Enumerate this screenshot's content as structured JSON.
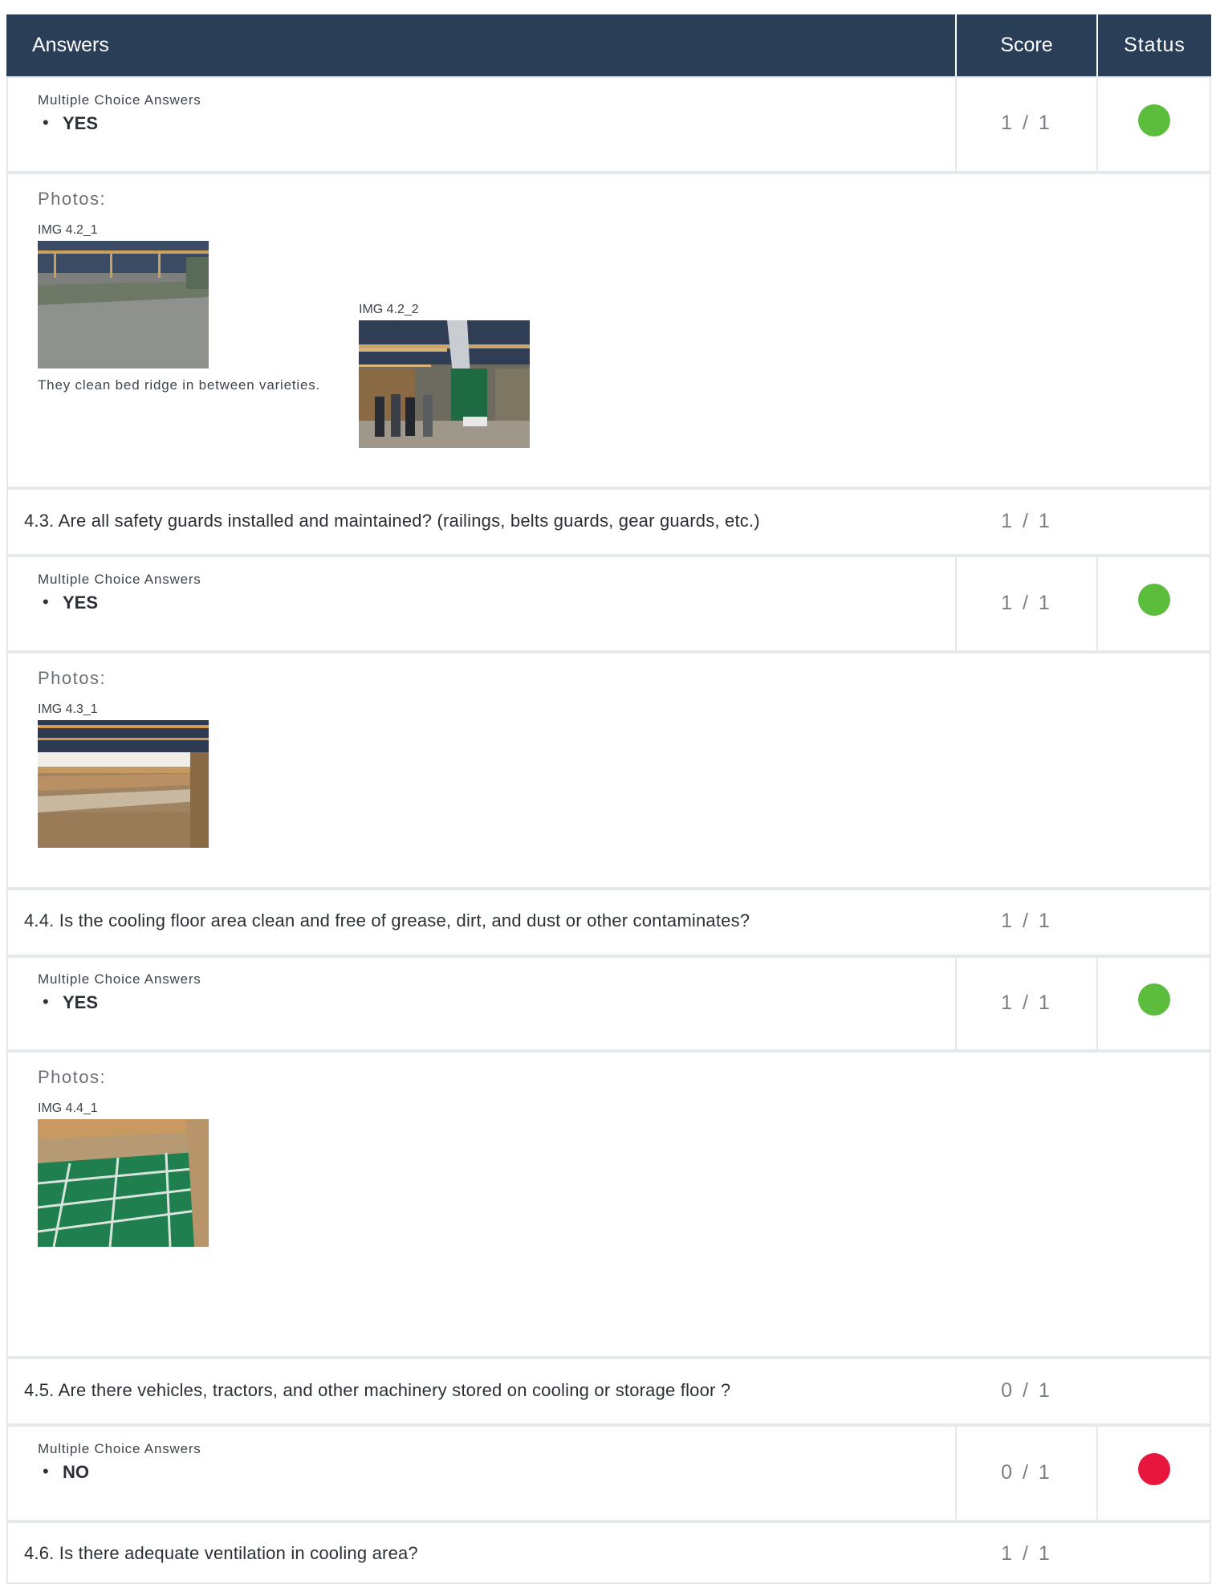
{
  "header": {
    "answers": "Answers",
    "score": "Score",
    "status": "Status"
  },
  "colors": {
    "header_bg": "#2b3e57",
    "pass": "#5cbc3c",
    "fail": "#e8163c",
    "border": "#e6e9ec"
  },
  "rows": {
    "a1": {
      "label": "Multiple Choice Answers",
      "bullet": "•",
      "answer": "YES",
      "score": "1 / 1",
      "status": "pass"
    },
    "p1": {
      "label": "Photos:",
      "img1": {
        "label": "IMG 4.2_1",
        "caption": "They clean bed ridge in between varieties."
      },
      "img2": {
        "label": "IMG 4.2_2"
      }
    },
    "q43": {
      "text": "4.3. Are all safety guards installed and maintained? (railings, belts guards, gear guards, etc.)",
      "score": "1 / 1"
    },
    "a2": {
      "label": "Multiple Choice Answers",
      "bullet": "•",
      "answer": "YES",
      "score": "1 / 1",
      "status": "pass"
    },
    "p2": {
      "label": "Photos:",
      "img1": {
        "label": "IMG 4.3_1"
      }
    },
    "q44": {
      "text": "4.4. Is the cooling floor area clean and free of grease, dirt, and dust or other contaminates?",
      "score": "1 / 1"
    },
    "a3": {
      "label": "Multiple Choice Answers",
      "bullet": "•",
      "answer": "YES",
      "score": "1 / 1",
      "status": "pass"
    },
    "p3": {
      "label": "Photos:",
      "img1": {
        "label": "IMG 4.4_1"
      }
    },
    "q45": {
      "text": "4.5. Are there vehicles, tractors, and other machinery stored on cooling or storage floor ?",
      "score": "0 / 1"
    },
    "a4": {
      "label": "Multiple Choice Answers",
      "bullet": "•",
      "answer": "NO",
      "score": "0 / 1",
      "status": "fail"
    },
    "q46": {
      "text": "4.6. Is there adequate ventilation in cooling area?",
      "score": "1 / 1"
    }
  }
}
